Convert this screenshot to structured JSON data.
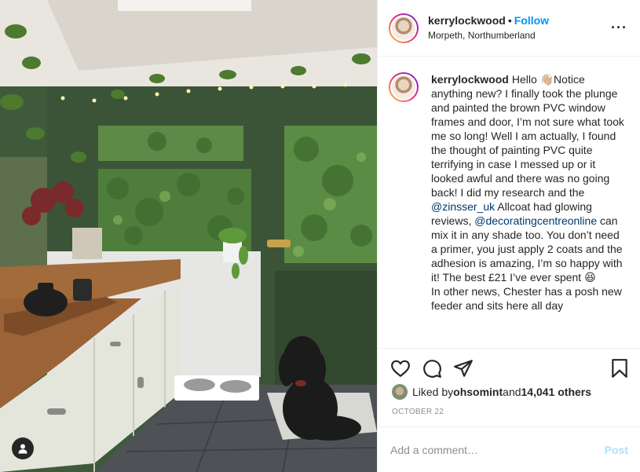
{
  "post": {
    "image_alt": "Kitchen with green painted window frames and a black dog"
  },
  "header": {
    "username": "kerrylockwood",
    "separator": "•",
    "follow_label": "Follow",
    "location": "Morpeth, Northumberland",
    "more_icon": "more-horizontal-icon"
  },
  "caption": {
    "username": "kerrylockwood",
    "text_1": "Hello 👋🏼Notice anything new? I finally took the plunge and painted the brown PVC window frames and door, I’m not sure what took me so long! Well I am actually, I found the thought of painting PVC quite terrifying in case I messed up or it looked awful and there was no going back! I did my research and the ",
    "mention_1": "@zinsser_uk",
    "text_2": " Allcoat had glowing reviews, ",
    "mention_2": "@decoratingcentreonline",
    "text_3": " can mix it in any shade too. You don’t need a primer, you just apply 2 coats and the adhesion is amazing, I’m so happy with it! The best £21 I’ve ever spent 😆",
    "text_4": "In other news, Chester has a posh new feeder and sits here all day"
  },
  "actions": {
    "like_icon": "heart-icon",
    "comment_icon": "comment-icon",
    "share_icon": "share-icon",
    "save_icon": "bookmark-icon"
  },
  "likes": {
    "prefix": "Liked by ",
    "liker": "ohsomint",
    "middle": " and ",
    "others": "14,041 others"
  },
  "date": "OCTOBER 22",
  "comment": {
    "placeholder": "Add a comment…",
    "post_label": "Post"
  },
  "colors": {
    "follow": "#0095f6",
    "post_disabled": "#b2dffc",
    "mention": "#00376b",
    "frame_green": "#3b5437"
  }
}
